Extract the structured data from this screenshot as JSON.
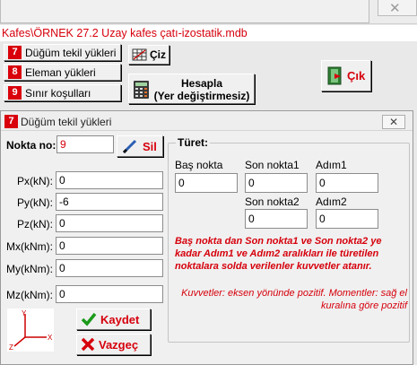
{
  "main": {
    "path": "Kafes\\ÖRNEK 27.2 Uzay kafes çatı-izostatik.mdb",
    "menu": [
      {
        "num": "7",
        "label": "Düğüm tekil yükleri"
      },
      {
        "num": "8",
        "label": "Eleman yükleri"
      },
      {
        "num": "9",
        "label": "Sınır koşulları"
      }
    ],
    "ciz_label": "Çiz",
    "hesapla_line1": "Hesapla",
    "hesapla_line2": "(Yer değiştirmesiz)",
    "cik_label": "Çık",
    "close_glyph": "✕"
  },
  "dialog": {
    "title_num": "7",
    "title": "Düğüm tekil yükleri",
    "close_glyph": "✕",
    "nokta_label": "Nokta no:",
    "nokta_value": "9",
    "sil_label": "Sil",
    "fields": [
      {
        "label": "Px(kN):",
        "value": "0"
      },
      {
        "label": "Py(kN):",
        "value": "-6"
      },
      {
        "label": "Pz(kN):",
        "value": "0"
      },
      {
        "label": "Mx(kNm):",
        "value": "0"
      },
      {
        "label": "My(kNm):",
        "value": "0"
      },
      {
        "label": "Mz(kNm):",
        "value": "0"
      }
    ],
    "kaydet_label": "Kaydet",
    "vazgec_label": "Vazgeç",
    "axes": {
      "y": "Y",
      "x": "X",
      "z": "Z"
    },
    "turet": {
      "title": "Türet:",
      "bas_nokta_label": "Baş nokta",
      "son_nokta1_label": "Son nokta1",
      "adim1_label": "Adım1",
      "son_nokta2_label": "Son nokta2",
      "adim2_label": "Adım2",
      "bas_nokta_value": "0",
      "son_nokta1_value": "0",
      "adim1_value": "0",
      "son_nokta2_value": "0",
      "adim2_value": "0",
      "warning": "Baş nokta dan Son nokta1 ve Son nokta2 ye kadar  Adım1 ve  Adım2 aralıkları ile türetilen noktalara solda verilenler kuvvetler atanır."
    },
    "note": "Kuvvetler: eksen yönünde pozitif. Momentler: sağ el kuralına göre pozitif"
  },
  "colors": {
    "accent_red": "#d6000c",
    "badge_red": "#d9000b",
    "check_green": "#1a9a1a"
  }
}
